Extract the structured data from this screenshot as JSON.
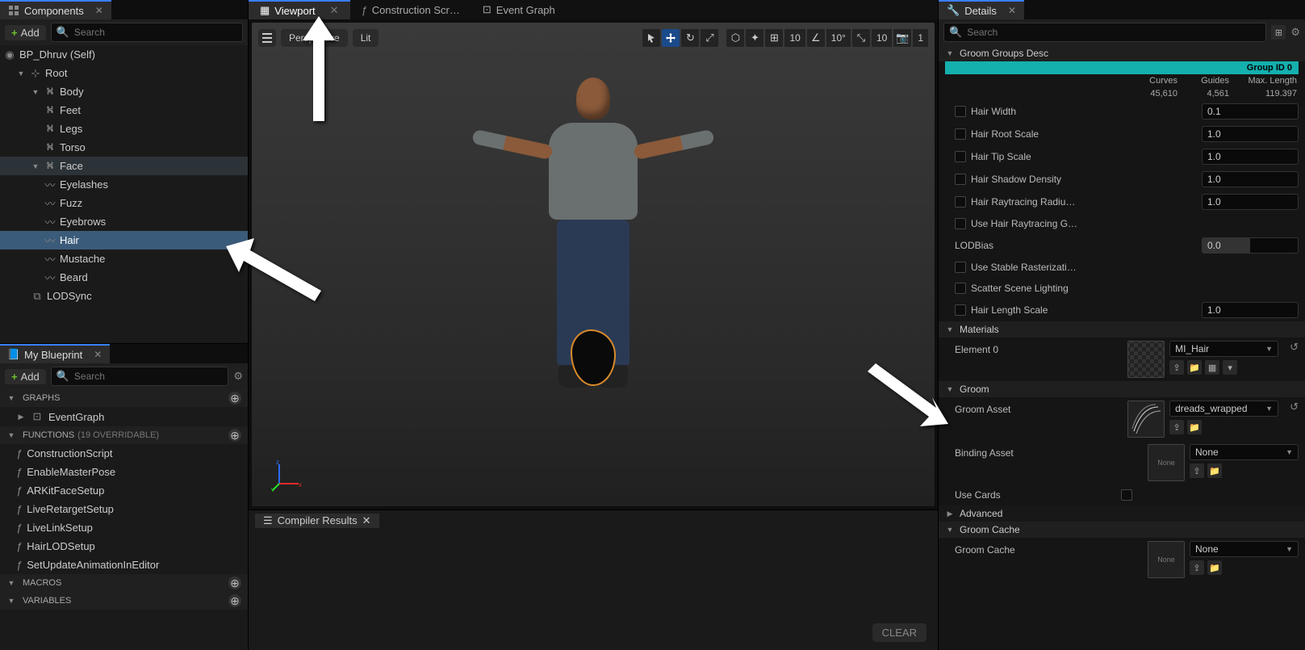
{
  "components_panel": {
    "title": "Components",
    "add_label": "Add",
    "search_placeholder": "Search",
    "tree": {
      "root_self": "BP_Dhruv (Self)",
      "root": "Root",
      "body": "Body",
      "feet": "Feet",
      "legs": "Legs",
      "torso": "Torso",
      "face": "Face",
      "eyelashes": "Eyelashes",
      "fuzz": "Fuzz",
      "eyebrows": "Eyebrows",
      "hair": "Hair",
      "mustache": "Mustache",
      "beard": "Beard",
      "lodsync": "LODSync"
    }
  },
  "myblueprint": {
    "title": "My Blueprint",
    "add_label": "Add",
    "search_placeholder": "Search",
    "sections": {
      "graphs": "GRAPHS",
      "eventgraph": "EventGraph",
      "functions_label": "FUNCTIONS",
      "functions_hint": "(19 OVERRIDABLE)",
      "funcs": {
        "construction": "ConstructionScript",
        "enablemaster": "EnableMasterPose",
        "arkit": "ARKitFaceSetup",
        "liveretarget": "LiveRetargetSetup",
        "livelink": "LiveLinkSetup",
        "hairlod": "HairLODSetup",
        "setupdate": "SetUpdateAnimationInEditor"
      },
      "macros": "MACROS",
      "variables": "VARIABLES"
    }
  },
  "center": {
    "tabs": {
      "viewport": "Viewport",
      "construction": "Construction Scr…",
      "eventgraph": "Event Graph"
    },
    "vp_buttons": {
      "perspective": "Perspective",
      "lit": "Lit"
    },
    "toolbar_vals": {
      "grid": "10",
      "angle": "10°",
      "scale": "10",
      "cam": "1"
    },
    "compiler_title": "Compiler Results",
    "clear": "CLEAR"
  },
  "details": {
    "title": "Details",
    "search_placeholder": "Search",
    "groom_groups_desc": "Groom Groups Desc",
    "group_id": "Group ID 0",
    "stats_headers": {
      "curves": "Curves",
      "guides": "Guides",
      "maxlen": "Max. Length"
    },
    "stats_values": {
      "curves": "45,610",
      "guides": "4,561",
      "maxlen": "119.397"
    },
    "props": {
      "hair_width": {
        "label": "Hair Width",
        "value": "0.1"
      },
      "hair_root_scale": {
        "label": "Hair Root Scale",
        "value": "1.0"
      },
      "hair_tip_scale": {
        "label": "Hair Tip Scale",
        "value": "1.0"
      },
      "hair_shadow_density": {
        "label": "Hair Shadow Density",
        "value": "1.0"
      },
      "hair_raytracing_radius": {
        "label": "Hair Raytracing Radiu…",
        "value": "1.0"
      },
      "use_hair_raytracing": {
        "label": "Use Hair Raytracing G…"
      },
      "lodbias": {
        "label": "LODBias",
        "value": "0.0"
      },
      "use_stable_raster": {
        "label": "Use Stable Rasterizati…"
      },
      "scatter_scene_lighting": {
        "label": "Scatter Scene Lighting"
      },
      "hair_length_scale": {
        "label": "Hair Length Scale",
        "value": "1.0"
      }
    },
    "materials": "Materials",
    "element0": "Element 0",
    "mi_hair": "MI_Hair",
    "groom": "Groom",
    "groom_asset": {
      "label": "Groom Asset",
      "value": "dreads_wrapped"
    },
    "binding_asset": {
      "label": "Binding Asset",
      "value": "None",
      "thumb": "None"
    },
    "use_cards": "Use Cards",
    "advanced": "Advanced",
    "groom_cache_cat": "Groom Cache",
    "groom_cache": {
      "label": "Groom Cache",
      "value": "None",
      "thumb": "None"
    }
  }
}
